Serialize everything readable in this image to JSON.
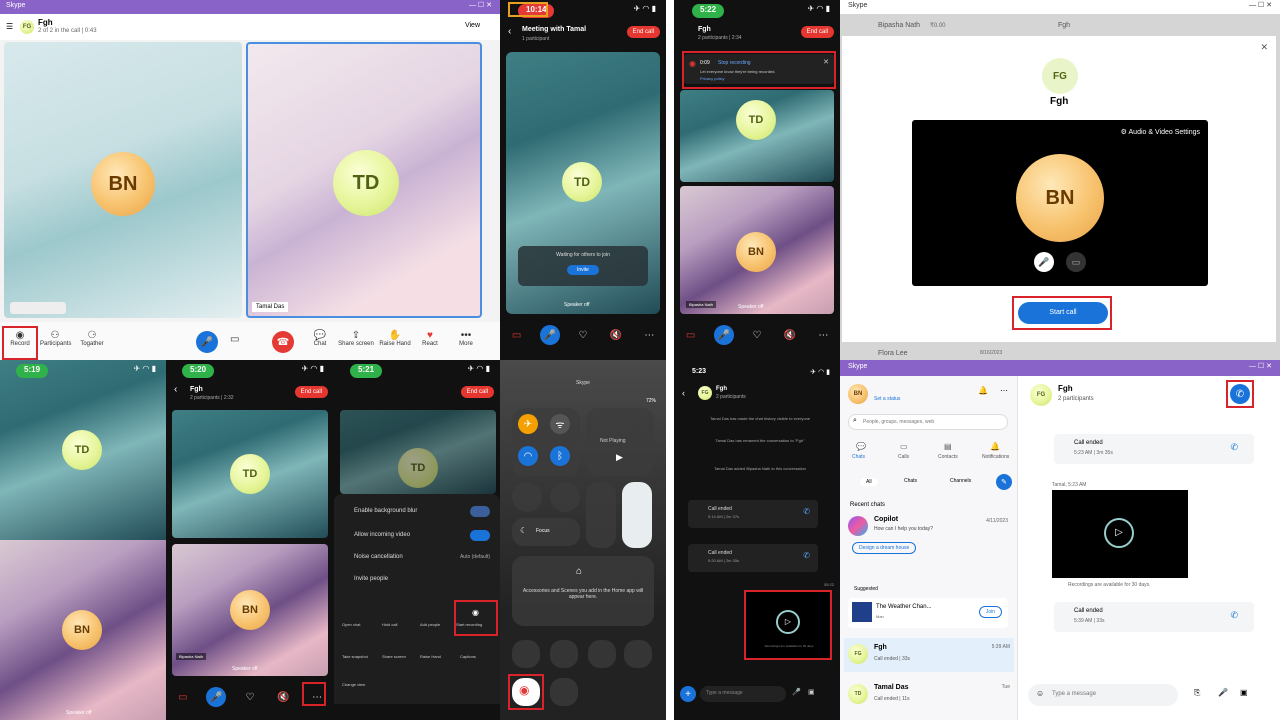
{
  "p1": {
    "app_title": "Skype",
    "chat_name": "Fgh",
    "avatar": "FG",
    "call_status": "2 of 2 in the call | 0:43",
    "view_label": "View",
    "bn": "BN",
    "td": "TD",
    "td_name": "Tamal Das",
    "toolbar": {
      "record": "Record",
      "participants": "Participants",
      "together": "Togather",
      "chat": "Chat",
      "share": "Share screen",
      "raise": "Raise Hand",
      "react": "React",
      "more": "More"
    }
  },
  "p2": {
    "time": "10:14",
    "title": "Meeting with Tamal",
    "sub": "1 participant",
    "end": "End call",
    "td": "TD",
    "waiting": "Waiting for others to join",
    "invite": "Invite",
    "speaker": "Speaker off"
  },
  "p3": {
    "time": "5:22",
    "name": "Fgh",
    "sub": "2 participants | 2:34",
    "end": "End call",
    "rec_time": "0:09",
    "rec_stop": "Stop recording",
    "rec_msg": "Let everyone know they're being recorded.",
    "rec_link": "Privacy policy",
    "td": "TD",
    "bn": "BN",
    "bn_name": "Bipasha Nath",
    "speaker": "Speaker off"
  },
  "p4": {
    "app_title": "Skype",
    "back_name": "Bipasha Nath",
    "back_meta": "₹0.00",
    "back_right": "Fgh",
    "avatar": "FG",
    "name": "Fgh",
    "settings": "Audio & Video Settings",
    "bn": "BN",
    "start": "Start call",
    "bottom_name": "Flora Lee",
    "bottom_date": "8/16/2023"
  },
  "p5": {
    "time": "5:19",
    "td": "TD",
    "bn": "BN",
    "speaker": "Speaker off"
  },
  "p6": {
    "time": "5:20",
    "name": "Fgh",
    "sub": "2 participants | 2:32",
    "end": "End call",
    "td": "TD",
    "bn": "BN",
    "bn_name": "Bipasha Nath",
    "speaker": "Speaker off"
  },
  "p7": {
    "time": "5:21",
    "end": "End call",
    "td": "TD",
    "menu": [
      "Enable background blur",
      "Allow incoming video",
      "Noise cancellation",
      "Invite people"
    ],
    "noise_val": "Auto (default)",
    "grid": [
      "Open chat",
      "Hold call",
      "Add people",
      "Start recording",
      "Take snapshot",
      "Share screen",
      "Raise Hand",
      "Captions",
      "Change view"
    ]
  },
  "p8": {
    "battery": "72%",
    "label": "Skype",
    "now": "Not Playing",
    "focus": "Focus",
    "home": "Accessories and Scenes you add in the Home app will appear here."
  },
  "p9": {
    "time": "5:23",
    "avatar": "FG",
    "name": "Fgh",
    "sub": "2 participants",
    "sys1": "Tamal Das has made the chat history visible to everyone",
    "sys2": "Tamal Das has renamed the conversation to \"Fgh\"",
    "sys3": "Tamal Das added Bipasha Nath to this conversation",
    "call1": "Call ended",
    "call1_meta": "5:14 AM | 2m 37s",
    "call2": "Call ended",
    "call2_meta": "5:20 AM | 2m 35s",
    "video_note": "Recordings are available for 30 days",
    "input": "Type a message",
    "time_stamp": "05:22"
  },
  "p10": {
    "app_title": "Skype",
    "user_av": "BN",
    "status": "Set a status",
    "search": "People, groups, messages, web",
    "tabs": [
      "Chats",
      "Calls",
      "Contacts",
      "Notifications"
    ],
    "filters": [
      "All",
      "Chats",
      "Channels"
    ],
    "recent": "Recent chats",
    "copilot": "Copilot",
    "copilot_msg": "How can I help you today?",
    "copilot_date": "4/11/2023",
    "copilot_btn": "Design a dream house",
    "suggested": "Suggested",
    "weather": "The Weather Chan...",
    "weather_sub": "Man",
    "join": "Join",
    "chat_fgh": "Fgh",
    "fgh_meta": "Call ended | 33s",
    "fgh_time": "5:39 AM",
    "tamal": "Tamal Das",
    "tamal_meta": "Call ended | 11s",
    "tamal_time": "Tue",
    "header_av": "FG",
    "header_name": "Fgh",
    "header_sub": "2 participants",
    "call_a": "Call ended",
    "call_a_meta": "5:23 AM | 3m 35s",
    "tamal_label": "Tamal, 5:23 AM",
    "rec_note": "Recordings are available for 30 days.",
    "call_b": "Call ended",
    "call_b_meta": "5:39 AM | 33s",
    "composer": "Type a message"
  }
}
